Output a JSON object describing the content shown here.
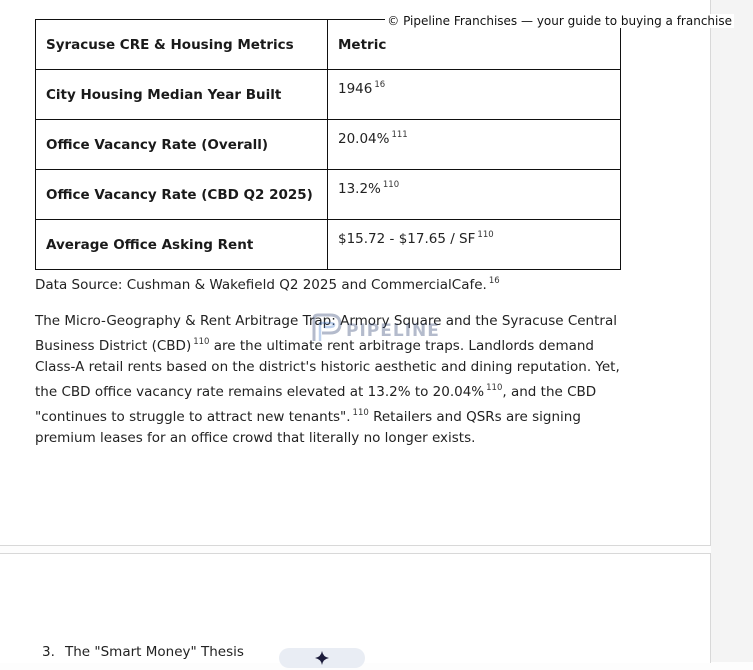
{
  "watermark": {
    "caption": "© Pipeline Franchises — your guide to buying a franchise",
    "logo_text": "PIPELINE"
  },
  "table": {
    "headers": [
      "Syracuse CRE & Housing Metrics",
      "Metric"
    ],
    "rows": [
      {
        "label": "City Housing Median Year Built",
        "value": "1946",
        "ref": "16"
      },
      {
        "label": "Office Vacancy Rate (Overall)",
        "value": "20.04%",
        "ref": "111"
      },
      {
        "label": "Office Vacancy Rate (CBD Q2 2025)",
        "value": "13.2%",
        "ref": "110"
      },
      {
        "label": "Average Office Asking Rent",
        "value": "$15.72 - $17.65 / SF",
        "ref": "110"
      }
    ]
  },
  "source": {
    "text": "Data Source: Cushman & Wakefield Q2 2025 and CommercialCafe.",
    "ref": "16"
  },
  "paragraph": {
    "part1": "The Micro-Geography & Rent Arbitrage Trap: Armory Square and the Syracuse Central Business District (CBD)",
    "ref1": "110",
    "part2": "are the ultimate rent arbitrage traps. Landlords demand Class-A retail rents based on the district's historic aesthetic and dining reputation. Yet, the CBD office vacancy rate remains elevated at 13.2% to 20.04%",
    "ref2": "110",
    "part3": ", and the CBD \"continues to struggle to attract new tenants\".",
    "ref3": "110",
    "part4": "Retailers and QSRs are signing premium leases for an office crowd that literally no longer exists."
  },
  "list_item": {
    "number": "3.",
    "text": "The \"Smart Money\" Thesis"
  },
  "icons": {
    "sparkle": "sparkle-icon",
    "logo_mark": "pipeline-logo-icon"
  }
}
